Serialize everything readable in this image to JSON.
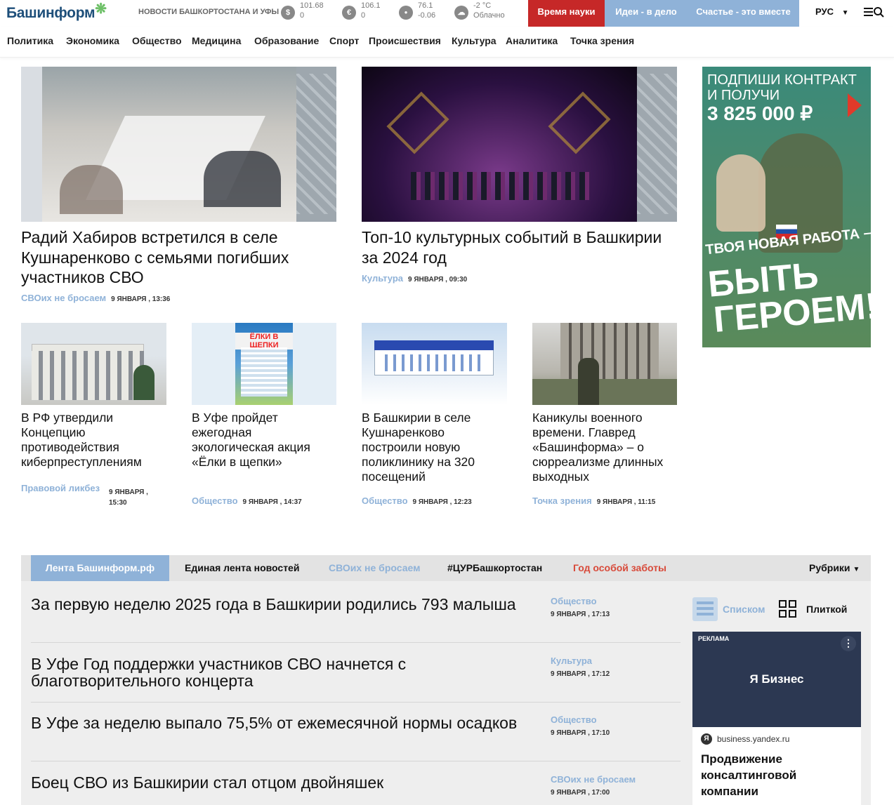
{
  "header": {
    "logo": "Башинформ",
    "news_label": "НОВОСТИ БАШКОРТОСТАНА И УФЫ",
    "rates": [
      {
        "icon": "dollar-icon",
        "symbol": "$",
        "value": "101.68",
        "delta": "0"
      },
      {
        "icon": "euro-icon",
        "symbol": "€",
        "value": "106.1",
        "delta": "0"
      },
      {
        "icon": "oil-drop-icon",
        "symbol": "●",
        "value": "76.1",
        "delta": "-0.06"
      }
    ],
    "weather": {
      "icon": "cloud-icon",
      "temp": "-2 °C",
      "desc": "Облачно"
    },
    "buttons": [
      "Время науки",
      "Идеи - в дело",
      "Счастье - это вместе"
    ],
    "lang": "РУС",
    "colors": {
      "red": "#c62828",
      "blue": "#8fb2d8",
      "brand": "#1e4f7a"
    }
  },
  "nav": [
    "Политика",
    "Экономика",
    "Общество",
    "Медицина",
    "Образование",
    "Спорт",
    "Происшествия",
    "Культура",
    "Аналитика",
    "Точка зрения"
  ],
  "top_stories": [
    {
      "title": "Радий Хабиров встретился в селе Кушнаренково с семьями погибших участников СВО",
      "cat": "СВОих не бросаем",
      "date": "9 ЯНВАРЯ , 13:36"
    },
    {
      "title": "Топ-10 культурных событий в Башкирии за 2024 год",
      "cat": "Культура",
      "date": "9 ЯНВАРЯ , 09:30"
    }
  ],
  "banner": {
    "line1": "ПОДПИШИ КОНТРАКТ",
    "line2": "И ПОЛУЧИ",
    "amount": "3 825 000 ₽",
    "slogan1": "ТВОЯ НОВАЯ РАБОТА –",
    "slogan2": "БЫТЬ",
    "slogan3": "ГЕРОЕМ!"
  },
  "small_stories": [
    {
      "title": "В РФ утвердили Концепцию противодействия киберпреступлениям",
      "cat": "Правовой ликбез",
      "date": "9 ЯНВАРЯ , 15:30"
    },
    {
      "title": "В Уфе пройдет ежегодная экологическая акция «Ёлки в щепки»",
      "cat": "Общество",
      "date": "9 ЯНВАРЯ , 14:37",
      "img_text": "ЁЛКИ В ЩЕПКИ"
    },
    {
      "title": "В Башкирии в селе Кушнаренково построили новую поликлинику на 320 посещений",
      "cat": "Общество",
      "date": "9 ЯНВАРЯ , 12:23"
    },
    {
      "title": "Каникулы военного времени. Главред «Башинформа» – о сюрреализме длинных выходных",
      "cat": "Точка зрения",
      "date": "9 ЯНВАРЯ , 11:15"
    }
  ],
  "feed": {
    "tabs": [
      "Лента Башинформ.рф",
      "Единая лента новостей",
      "СВОих не бросаем",
      "#ЦУРБашкортостан",
      "Год особой заботы"
    ],
    "rubrics": "Рубрики",
    "items": [
      {
        "title": "За первую неделю 2025 года в Башкирии родились 793 малыша",
        "cat": "Общество",
        "date": "9 ЯНВАРЯ , 17:13"
      },
      {
        "title": "В Уфе Год поддержки участников СВО начнется с благотворительного концерта",
        "cat": "Культура",
        "date": "9 ЯНВАРЯ , 17:12"
      },
      {
        "title": "В Уфе за неделю выпало 75,5% от ежемесячной нормы осадков",
        "cat": "Общество",
        "date": "9 ЯНВАРЯ , 17:10"
      },
      {
        "title": "Боец СВО из Башкирии стал отцом двойняшек",
        "cat": "СВОих не бросаем",
        "date": "9 ЯНВАРЯ , 17:00"
      }
    ],
    "view_list": "Списком",
    "view_tile": "Плиткой",
    "ad": {
      "label": "РЕКЛАМА",
      "brand": "Я Бизнес",
      "domain": "business.yandex.ru",
      "title": "Продвижение консалтинговой компании"
    }
  }
}
